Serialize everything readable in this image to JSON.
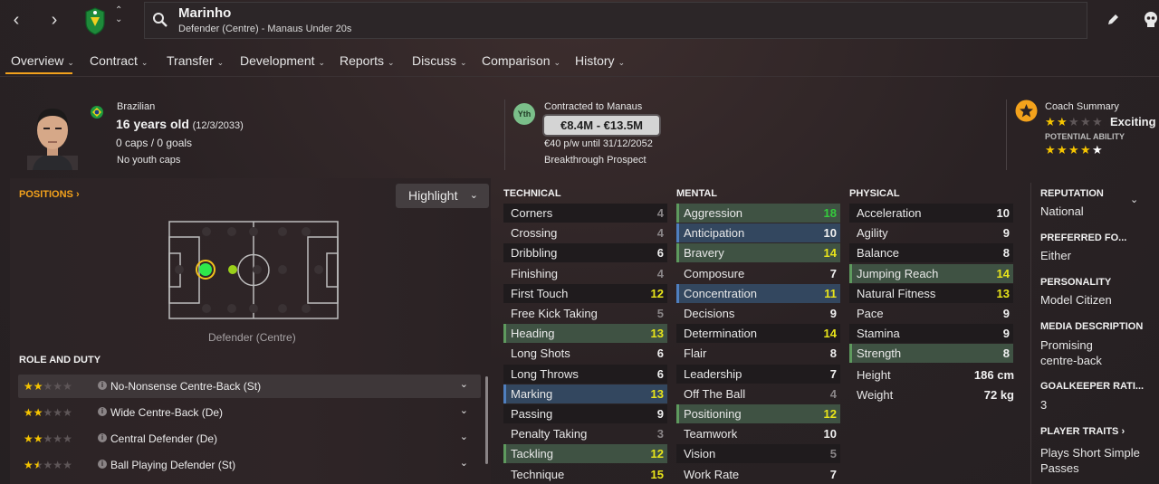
{
  "header": {
    "player_name": "Marinho",
    "subtitle": "Defender (Centre) - Manaus Under 20s"
  },
  "tabs": [
    {
      "label": "Overview"
    },
    {
      "label": "Contract"
    },
    {
      "label": "Transfer"
    },
    {
      "label": "Development"
    },
    {
      "label": "Reports"
    },
    {
      "label": "Discuss"
    },
    {
      "label": "Comparison"
    },
    {
      "label": "History"
    }
  ],
  "profile": {
    "nationality": "Brazilian",
    "age": "16 years old",
    "dob": "(12/3/2033)",
    "caps": "0 caps / 0 goals",
    "youth_caps": "No youth caps"
  },
  "contract": {
    "badge": "Yth",
    "contracted_to": "Contracted to Manaus",
    "value_range": "€8.4M - €13.5M",
    "wage": "€40 p/w until 31/12/2052",
    "status": "Breakthrough Prospect"
  },
  "coach": {
    "title": "Coach Summary",
    "summary_word": "Exciting y",
    "current_stars": 2,
    "potential_label": "POTENTIAL ABILITY",
    "potential_stars": 4
  },
  "positions": {
    "title": "POSITIONS",
    "position_label": "Defender (Centre)",
    "highlight_label": "Highlight"
  },
  "roles": {
    "title": "ROLE AND DUTY",
    "items": [
      {
        "label": "No-Nonsense Centre-Back (St)",
        "stars": 2
      },
      {
        "label": "Wide Centre-Back (De)",
        "stars": 2
      },
      {
        "label": "Central Defender (De)",
        "stars": 2
      },
      {
        "label": "Ball Playing Defender (St)",
        "stars": 1.5
      }
    ]
  },
  "technical": {
    "title": "TECHNICAL",
    "items": [
      {
        "name": "Corners",
        "value": "4"
      },
      {
        "name": "Crossing",
        "value": "4"
      },
      {
        "name": "Dribbling",
        "value": "6"
      },
      {
        "name": "Finishing",
        "value": "4"
      },
      {
        "name": "First Touch",
        "value": "12"
      },
      {
        "name": "Free Kick Taking",
        "value": "5"
      },
      {
        "name": "Heading",
        "value": "13"
      },
      {
        "name": "Long Shots",
        "value": "6"
      },
      {
        "name": "Long Throws",
        "value": "6"
      },
      {
        "name": "Marking",
        "value": "13"
      },
      {
        "name": "Passing",
        "value": "9"
      },
      {
        "name": "Penalty Taking",
        "value": "3"
      },
      {
        "name": "Tackling",
        "value": "12"
      },
      {
        "name": "Technique",
        "value": "15"
      }
    ]
  },
  "mental": {
    "title": "MENTAL",
    "items": [
      {
        "name": "Aggression",
        "value": "18"
      },
      {
        "name": "Anticipation",
        "value": "10"
      },
      {
        "name": "Bravery",
        "value": "14"
      },
      {
        "name": "Composure",
        "value": "7"
      },
      {
        "name": "Concentration",
        "value": "11"
      },
      {
        "name": "Decisions",
        "value": "9"
      },
      {
        "name": "Determination",
        "value": "14"
      },
      {
        "name": "Flair",
        "value": "8"
      },
      {
        "name": "Leadership",
        "value": "7"
      },
      {
        "name": "Off The Ball",
        "value": "4"
      },
      {
        "name": "Positioning",
        "value": "12"
      },
      {
        "name": "Teamwork",
        "value": "10"
      },
      {
        "name": "Vision",
        "value": "5"
      },
      {
        "name": "Work Rate",
        "value": "7"
      }
    ]
  },
  "physical": {
    "title": "PHYSICAL",
    "items": [
      {
        "name": "Acceleration",
        "value": "10"
      },
      {
        "name": "Agility",
        "value": "9"
      },
      {
        "name": "Balance",
        "value": "8"
      },
      {
        "name": "Jumping Reach",
        "value": "14"
      },
      {
        "name": "Natural Fitness",
        "value": "13"
      },
      {
        "name": "Pace",
        "value": "9"
      },
      {
        "name": "Stamina",
        "value": "9"
      },
      {
        "name": "Strength",
        "value": "8"
      }
    ],
    "height_label": "Height",
    "height": "186 cm",
    "weight_label": "Weight",
    "weight": "72 kg"
  },
  "side": {
    "reputation_title": "REPUTATION",
    "reputation": "National",
    "foot_title": "PREFERRED FO...",
    "foot": "Either",
    "personality_title": "PERSONALITY",
    "personality": "Model Citizen",
    "media_title": "MEDIA DESCRIPTION",
    "media_line1": "Promising",
    "media_line2": "centre-back",
    "gk_title": "GOALKEEPER RATI...",
    "gk": "3",
    "traits_title": "PLAYER TRAITS",
    "trait_line1": "Plays Short Simple",
    "trait_line2": "Passes"
  },
  "colors": {
    "accent": "#f3a21c",
    "value_good": "#e8e41a",
    "value_great": "#34cc3c",
    "value_low": "#8a8688"
  }
}
